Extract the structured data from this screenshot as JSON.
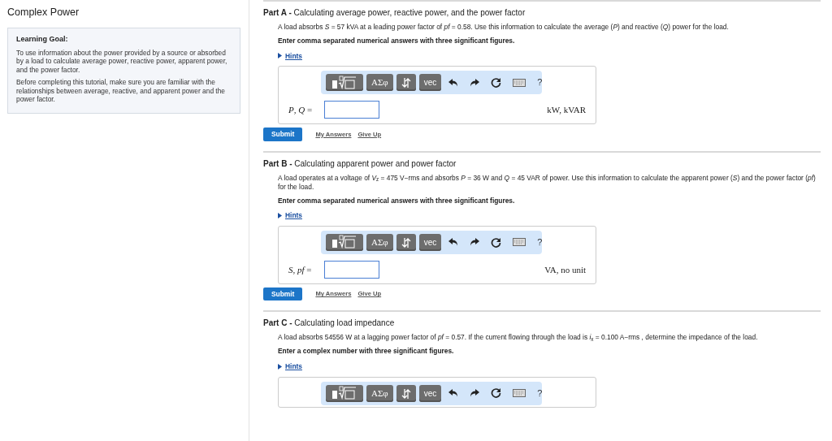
{
  "title": "Complex Power",
  "learning_goal": {
    "heading": "Learning Goal:",
    "paragraphs": [
      "To use information about the power provided by a source or absorbed by a load to calculate average power, reactive power, apparent power, and the power factor.",
      "Before completing this tutorial, make sure you are familiar with the relationships between average, reactive, and apparent power and the power factor."
    ]
  },
  "parts": [
    {
      "label": "Part A -",
      "title": "Calculating average power, reactive power, and the power factor",
      "problem": "A load absorbs *S* = 57 kVA at a leading power factor of *pf* = 0.58. Use this information to calculate the average (*P*) and reactive (*Q*) power for the load.",
      "instruction": "Enter comma separated numerical answers with three significant figures.",
      "hints": "Hints",
      "toolbar": {
        "symbols": "ΑΣφ",
        "vector": "vec",
        "help": "?"
      },
      "answer": {
        "label": "*P*, *Q* =",
        "units": "kW, kVAR"
      },
      "actions": {
        "submit": "Submit",
        "my_answers": "My Answers",
        "give_up": "Give Up"
      }
    },
    {
      "label": "Part B -",
      "title": "Calculating apparent power and power factor",
      "problem": "A load operates at a voltage of *V*$_{z}$ = 475 V−rms and absorbs *P* = 36 W and *Q* = 45 VAR of power. Use this information to calculate the apparent power (*S*) and the power factor (*pf*) for the load.",
      "instruction": "Enter comma separated numerical answers with three significant figures.",
      "hints": "Hints",
      "toolbar": {
        "symbols": "ΑΣφ",
        "vector": "vec",
        "help": "?"
      },
      "answer": {
        "label": "*S*, *pf* =",
        "units": "VA, no unit"
      },
      "actions": {
        "submit": "Submit",
        "my_answers": "My Answers",
        "give_up": "Give Up"
      }
    },
    {
      "label": "Part C -",
      "title": "Calculating load impedance",
      "problem": "A load absorbs 54556 W  at a lagging power factor of *pf* = 0.57. If the current flowing through the load is *i*$_{x}$ = 0.100 A−rms , determine the impedance of the load.",
      "instruction": "Enter a complex number with three significant figures.",
      "hints": "Hints",
      "toolbar": {
        "symbols": "ΑΣφ",
        "vector": "vec",
        "help": "?"
      }
    }
  ]
}
